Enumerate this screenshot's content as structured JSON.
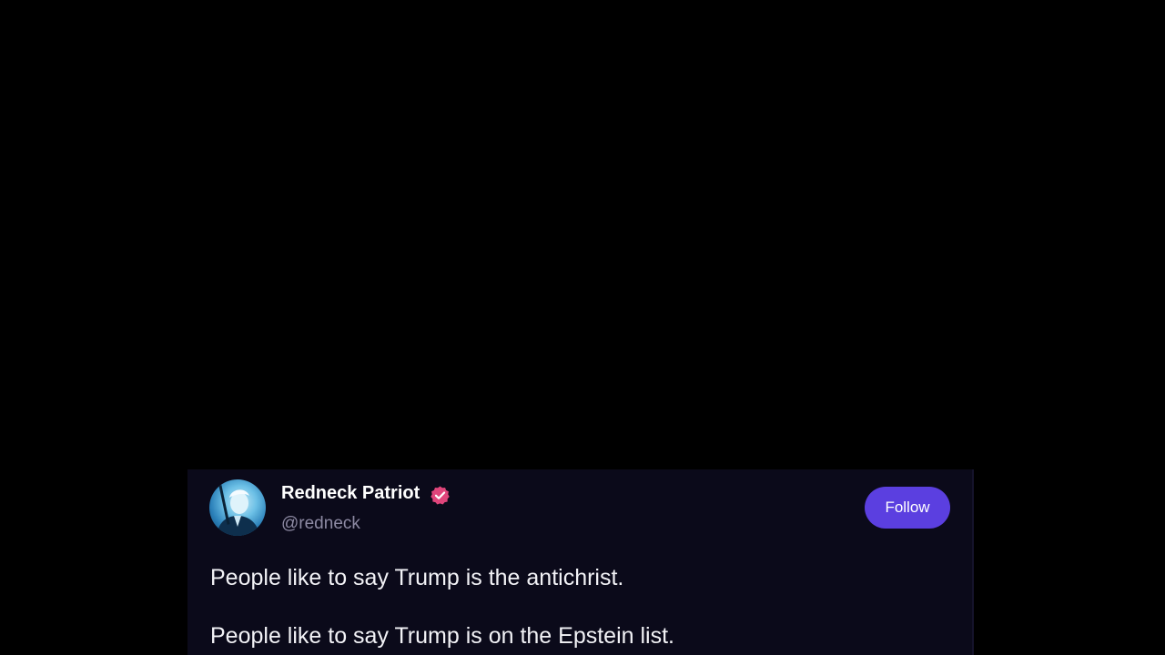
{
  "post": {
    "author": {
      "display_name": "Redneck Patriot",
      "handle": "@redneck",
      "verified": true,
      "verified_badge_color": "#e0457b"
    },
    "follow_label": "Follow",
    "follow_color": "#5b3fe0",
    "text_lines": [
      "People like to say Trump is the antichrist.",
      "People like to say Trump is on the Epstein list."
    ]
  },
  "icons": {
    "avatar": "avatar",
    "verified": "verified-badge-icon"
  }
}
